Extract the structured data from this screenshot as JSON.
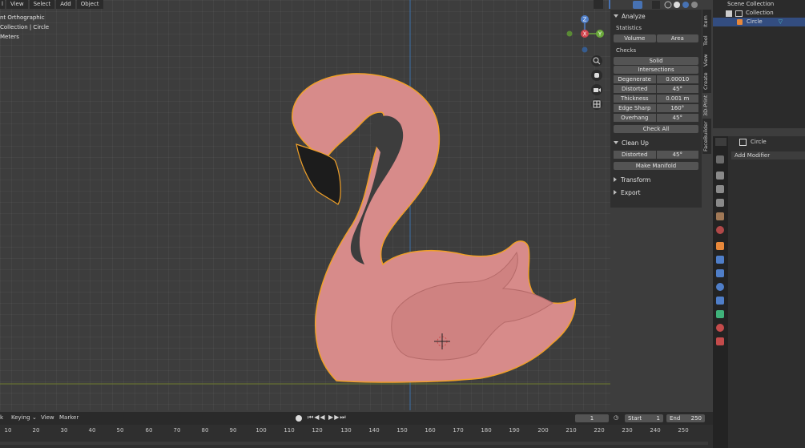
{
  "viewport": {
    "menu": [
      "View",
      "Select",
      "Add",
      "Object"
    ],
    "menu_prefix": "l",
    "overlay": [
      "nt Orthographic",
      "Collection | Circle",
      "Meters"
    ]
  },
  "npanel": {
    "analyze": {
      "title": "Analyze",
      "statistics_label": "Statistics",
      "volume": "Volume",
      "area": "Area",
      "checks_label": "Checks",
      "solid": "Solid",
      "intersections": "Intersections",
      "checks": [
        {
          "label": "Degenerate",
          "value": "0.00010"
        },
        {
          "label": "Distorted",
          "value": "45°"
        },
        {
          "label": "Thickness",
          "value": "0.001 m"
        },
        {
          "label": "Edge Sharp",
          "value": "160°"
        },
        {
          "label": "Overhang",
          "value": "45°"
        }
      ],
      "check_all": "Check All"
    },
    "cleanup": {
      "title": "Clean Up",
      "distorted_label": "Distorted",
      "distorted_value": "45°",
      "make_manifold": "Make Manifold"
    },
    "transform": "Transform",
    "export": "Export"
  },
  "vtabs": [
    "Item",
    "Tool",
    "View",
    "Create",
    "3D-Print",
    "FaceBuilder"
  ],
  "outliner": {
    "scene_collection": "Scene Collection",
    "collection": "Collection",
    "object": "Circle"
  },
  "properties": {
    "object_name": "Circle",
    "add_modifier": "Add Modifier"
  },
  "timeline": {
    "menu": [
      "Keying",
      "View",
      "Marker"
    ],
    "menu_prefix": "k",
    "current_frame": "1",
    "start_label": "Start",
    "start_value": "1",
    "end_label": "End",
    "end_value": "250",
    "ruler": [
      "10",
      "20",
      "30",
      "40",
      "50",
      "60",
      "70",
      "80",
      "90",
      "100",
      "110",
      "120",
      "130",
      "140",
      "150",
      "160",
      "170",
      "180",
      "190",
      "200",
      "210",
      "220",
      "230",
      "240",
      "250"
    ]
  },
  "colors": {
    "flamingo": "#d78b8a",
    "beak": "#1c1c1c",
    "outline": "#f0a028",
    "floor_line": "#6e7a30",
    "axis_blue": "#3a6fa8"
  }
}
